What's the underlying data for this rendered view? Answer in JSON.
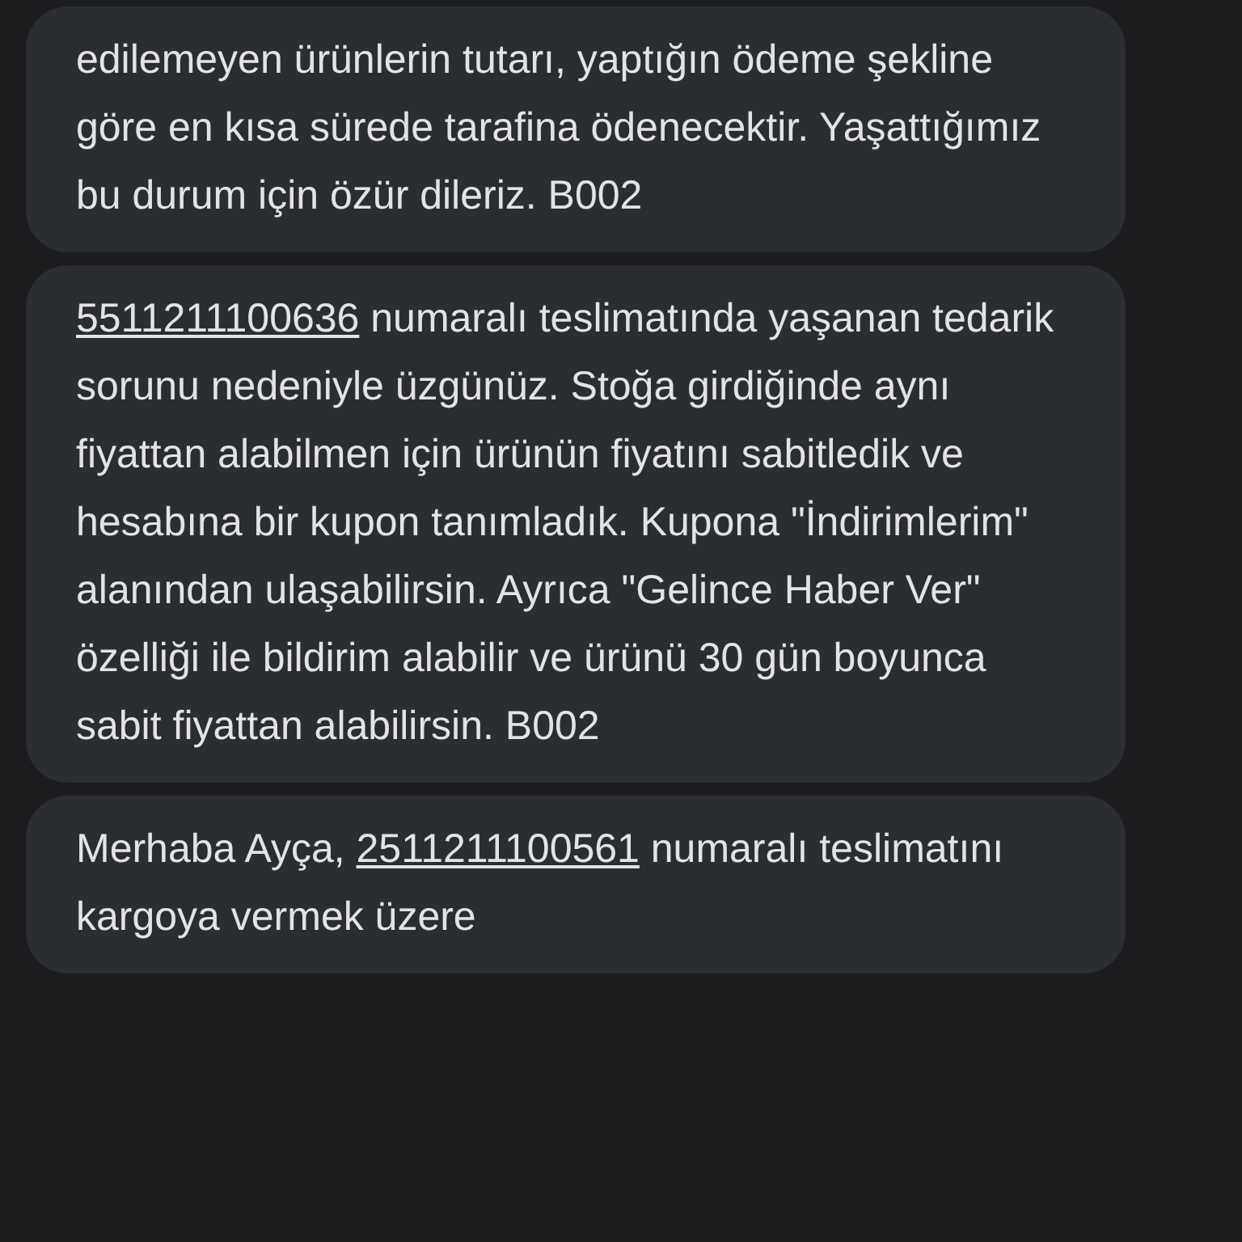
{
  "messages": [
    {
      "segments": [
        {
          "kind": "text",
          "text": "edilemeyen ürünlerin tutarı, yaptığın ödeme şekline göre en kısa sürede tarafina ödenecektir. Yaşattığımız bu durum için özür dileriz. B002"
        }
      ]
    },
    {
      "segments": [
        {
          "kind": "link",
          "text": "5511211100636"
        },
        {
          "kind": "text",
          "text": " numaralı teslimatında yaşanan tedarik sorunu nedeniyle üzgünüz. Stoğa girdiğinde aynı fiyattan alabilmen için ürünün fiyatını sabitledik ve hesabına bir kupon tanımladık. Kupona \"İndirimlerim\" alanından ulaşabilirsin. Ayrıca \"Gelince Haber Ver\" özelliği ile bildirim alabilir ve ürünü 30 gün boyunca sabit fiyattan alabilirsin. B002"
        }
      ]
    },
    {
      "segments": [
        {
          "kind": "text",
          "text": "Merhaba Ayça, "
        },
        {
          "kind": "link",
          "text": "2511211100561"
        },
        {
          "kind": "text",
          "text": " numaralı teslimatını kargoya vermek üzere"
        }
      ]
    }
  ]
}
